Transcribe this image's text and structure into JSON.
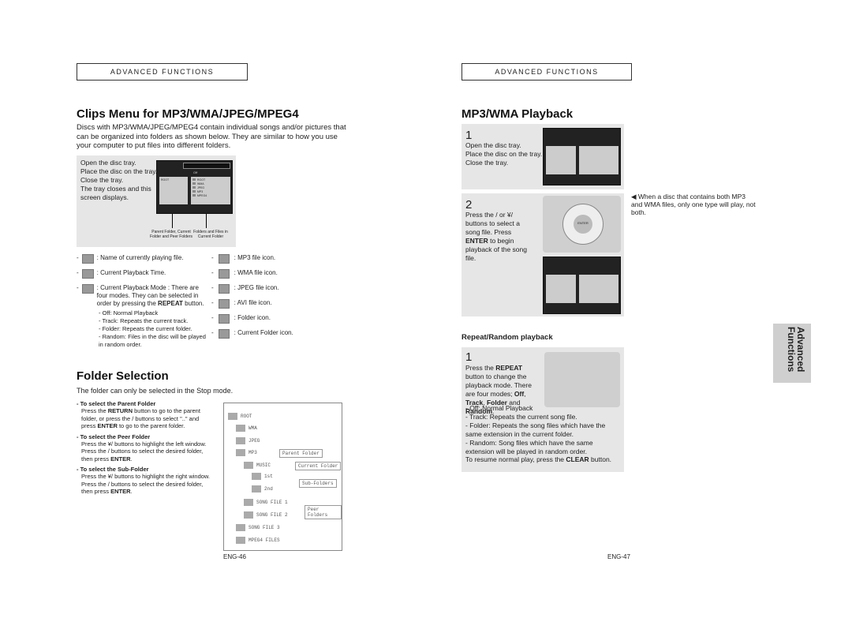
{
  "left": {
    "header": "Advanced Functions",
    "title": "Clips Menu for MP3/WMA/JPEG/MPEG4",
    "intro": "Discs with MP3/WMA/JPEG/MPEG4 contain individual songs and/or pictures that can be organized into folders as shown below. They are similar to how you use your computer to put files into different folders.",
    "box_text": [
      "Open the disc tray.",
      "Place the disc on the tray.",
      "Close the tray.",
      "The tray closes and this",
      "screen displays."
    ],
    "screen_mode": "Off",
    "screen_left_item": "ROOT",
    "screen_right_items": [
      "ROOT",
      "WMA",
      "JPEG",
      "MP3",
      "MPEG4"
    ],
    "arrow_label_left": "Parent Folder, Current Folder and Peer Folders",
    "arrow_label_right": "Folders and Files in Current Folder",
    "legend_left": [
      {
        "icon": "speaker-icon",
        "text": ": Name of currently playing file."
      },
      {
        "icon": "clock-icon",
        "text": ": Current Playback Time."
      },
      {
        "icon": "repeat-icon",
        "text": ": Current Playback Mode : There are four modes. They can be selected in order by pressing the REPEAT button."
      }
    ],
    "modes": [
      "- Off: Normal Playback",
      "- Track: Repeats the current track.",
      "- Folder: Repeats the current folder.",
      "- Random: Files in the disc will be played in random order."
    ],
    "legend_right": [
      {
        "icon": "mp3-file-icon",
        "text": ": MP3 file icon."
      },
      {
        "icon": "wma-file-icon",
        "text": ": WMA file icon."
      },
      {
        "icon": "jpeg-file-icon",
        "text": ": JPEG file icon."
      },
      {
        "icon": "avi-file-icon",
        "text": ": AVI file icon."
      },
      {
        "icon": "folder-icon",
        "text": ": Folder icon."
      },
      {
        "icon": "current-folder-icon",
        "text": ": Current Folder icon."
      }
    ],
    "folder_title": "Folder Selection",
    "folder_intro": "The folder can only be selected in the Stop mode.",
    "steps": [
      {
        "head": "- To select the Parent Folder",
        "body": "Press the RETURN button to go to the parent folder, or press the  /  buttons to select \"..\" and press ENTER to go to the parent folder."
      },
      {
        "head": "- To select the Peer Folder",
        "body": "Press the ¥/  buttons to highlight the left window. Press the  /  buttons to select the desired folder, then press ENTER."
      },
      {
        "head": "- To select the Sub-Folder",
        "body": "Press the ¥/  buttons to highlight the right window. Press the  /  buttons to select the desired folder, then press ENTER."
      }
    ],
    "tree": [
      "ROOT",
      "WMA",
      "JPEG",
      "MP3",
      "MUSIC",
      "1st",
      "2nd",
      "SONG FILE 1",
      "SONG FILE 2",
      "SONG FILE 3",
      "MPEG4 FILES"
    ],
    "tree_labels": [
      "Parent Folder",
      "Current Folder",
      "Sub-Folders",
      "Peer Folders"
    ],
    "page": "ENG-46"
  },
  "right": {
    "header": "Advanced Functions",
    "title": "MP3/WMA Playback",
    "step1_num": "1",
    "step1_text": [
      "Open the disc tray.",
      "Place the disc on the tray.",
      "Close the tray."
    ],
    "step2_num": "2",
    "step2_text": "Press the  /  or ¥/  buttons to select a song file. Press ENTER to begin playback of the song file.",
    "enter_label": "ENTER",
    "note": "When a disc that contains both MP3 and WMA files, only one type will play, not both.",
    "repeat_title": "Repeat/Random playback",
    "repeat_num": "1",
    "repeat_text": "Press the REPEAT button to change the playback mode. There are four modes; Off, Track, Folder and Random.",
    "repeat_modes": [
      "- Off: Normal Playback",
      "- Track: Repeats the current song file.",
      "- Folder: Repeats the song files which have the same extension in the current folder.",
      "- Random: Song files which have the same extension will be played in random order."
    ],
    "resume": "To resume normal play, press the CLEAR button.",
    "side_tab": [
      "Advanced",
      "Functions"
    ],
    "page": "ENG-47"
  }
}
